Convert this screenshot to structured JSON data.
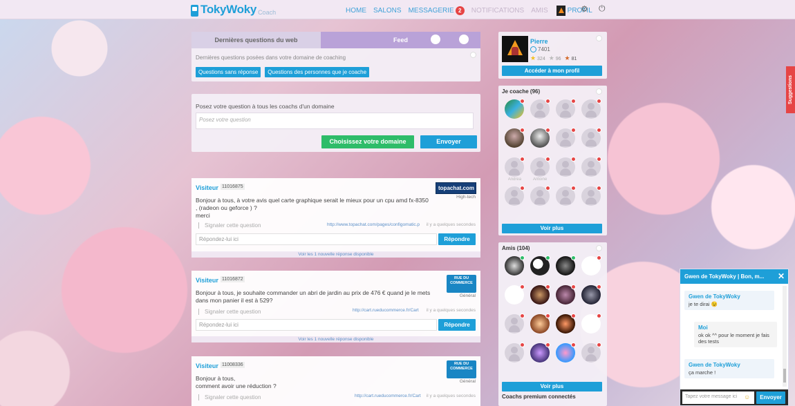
{
  "app": {
    "name": "TokyWoky",
    "sub": "Coach"
  },
  "nav": {
    "home": "HOME",
    "salons": "SALONS",
    "messagerie": "MESSAGERIE",
    "messagerie_count": "2",
    "notifications": "NOTIFICATIONS",
    "amis": "AMIS",
    "profil": "PROFIL"
  },
  "web_questions": {
    "tab1": "Dernières questions du web",
    "tab2": "Feed",
    "desc": "Dernières questions posées dans votre domaine de coaching",
    "btn1": "Questions sans réponse",
    "btn2": "Questions des personnes que je coache"
  },
  "ask": {
    "label": "Posez votre question à tous les coachs d'un domaine",
    "placeholder": "Posez votre question",
    "domain_btn": "Choisissez votre domaine",
    "send_btn": "Envoyer"
  },
  "questions": [
    {
      "user": "Visiteur",
      "id": "11016875",
      "text": "Bonjour à tous,  à votre avis quel carte graphique serait le mieux pour un cpu amd fx-8350 , (radeon ou geforce ) ?",
      "text2": "merci",
      "logo": "topachat.com",
      "category": "High-tech",
      "report": "Signaler cette question",
      "link": "http://www.topachat.com/pages/configomatic.p",
      "time": "il y a quelques secondes",
      "reply_placeholder": "Répondez-lui ici",
      "reply_btn": "Répondre",
      "more": "Voir les 1 nouvelle réponse disponible"
    },
    {
      "user": "Visiteur",
      "id": "11016872",
      "text": "Bonjour à tous, je souhaite commander un abri de jardin au prix de 476 € quand je le mets dans mon panier il est à 529?",
      "text2": "",
      "logo": "RUE DU COMMERCE",
      "category": "Général",
      "report": "Signaler cette question",
      "link": "http://cart.rueducommerce.fr/Cart",
      "time": "il y a quelques secondes",
      "reply_placeholder": "Répondez-lui ici",
      "reply_btn": "Répondre",
      "more": "Voir les 1 nouvelle réponse disponible"
    },
    {
      "user": "Visiteur",
      "id": "11008336",
      "text": "Bonjour à tous,",
      "text2": "comment avoir une réduction ?",
      "logo": "RUE DU COMMERCE",
      "category": "Général",
      "report": "Signaler cette question",
      "link": "http://cart.rueducommerce.fr/Cart",
      "time": "il y a quelques secondes"
    }
  ],
  "profile": {
    "name": "Pierre",
    "points": "7401",
    "gold": "324",
    "silver": "96",
    "bronze": "81",
    "btn": "Accéder à mon profil"
  },
  "coach": {
    "title": "Je coache (96)",
    "more": "Voir plus",
    "names": [
      "",
      "",
      "",
      "",
      "",
      "",
      "",
      "",
      "Andrea",
      "Antoine",
      "",
      "",
      "",
      "",
      "",
      "",
      "",
      "",
      "",
      "",
      "",
      "",
      "",
      ""
    ]
  },
  "friends": {
    "title": "Amis (104)",
    "more": "Voir plus",
    "names": [
      "",
      "",
      "",
      "",
      "",
      "",
      "",
      "",
      "",
      "",
      "",
      "",
      "",
      "",
      "",
      "",
      "",
      "",
      "",
      "",
      "",
      "",
      "",
      ""
    ]
  },
  "premium": {
    "title": "Coachs premium connectés"
  },
  "suggestions": "Suggestions",
  "chat": {
    "title": "Gwen de TokyWoky | Bon, m...",
    "messages": [
      {
        "who": "Gwen de TokyWoky",
        "text": "je te dirai 😉"
      },
      {
        "who": "Moi",
        "text": "ok ok ^^ pour le moment je fais des tests"
      },
      {
        "who": "Gwen de TokyWoky",
        "text": "ça marche !"
      }
    ],
    "placeholder": "Tapez votre message ici",
    "send": "Envoyer"
  }
}
